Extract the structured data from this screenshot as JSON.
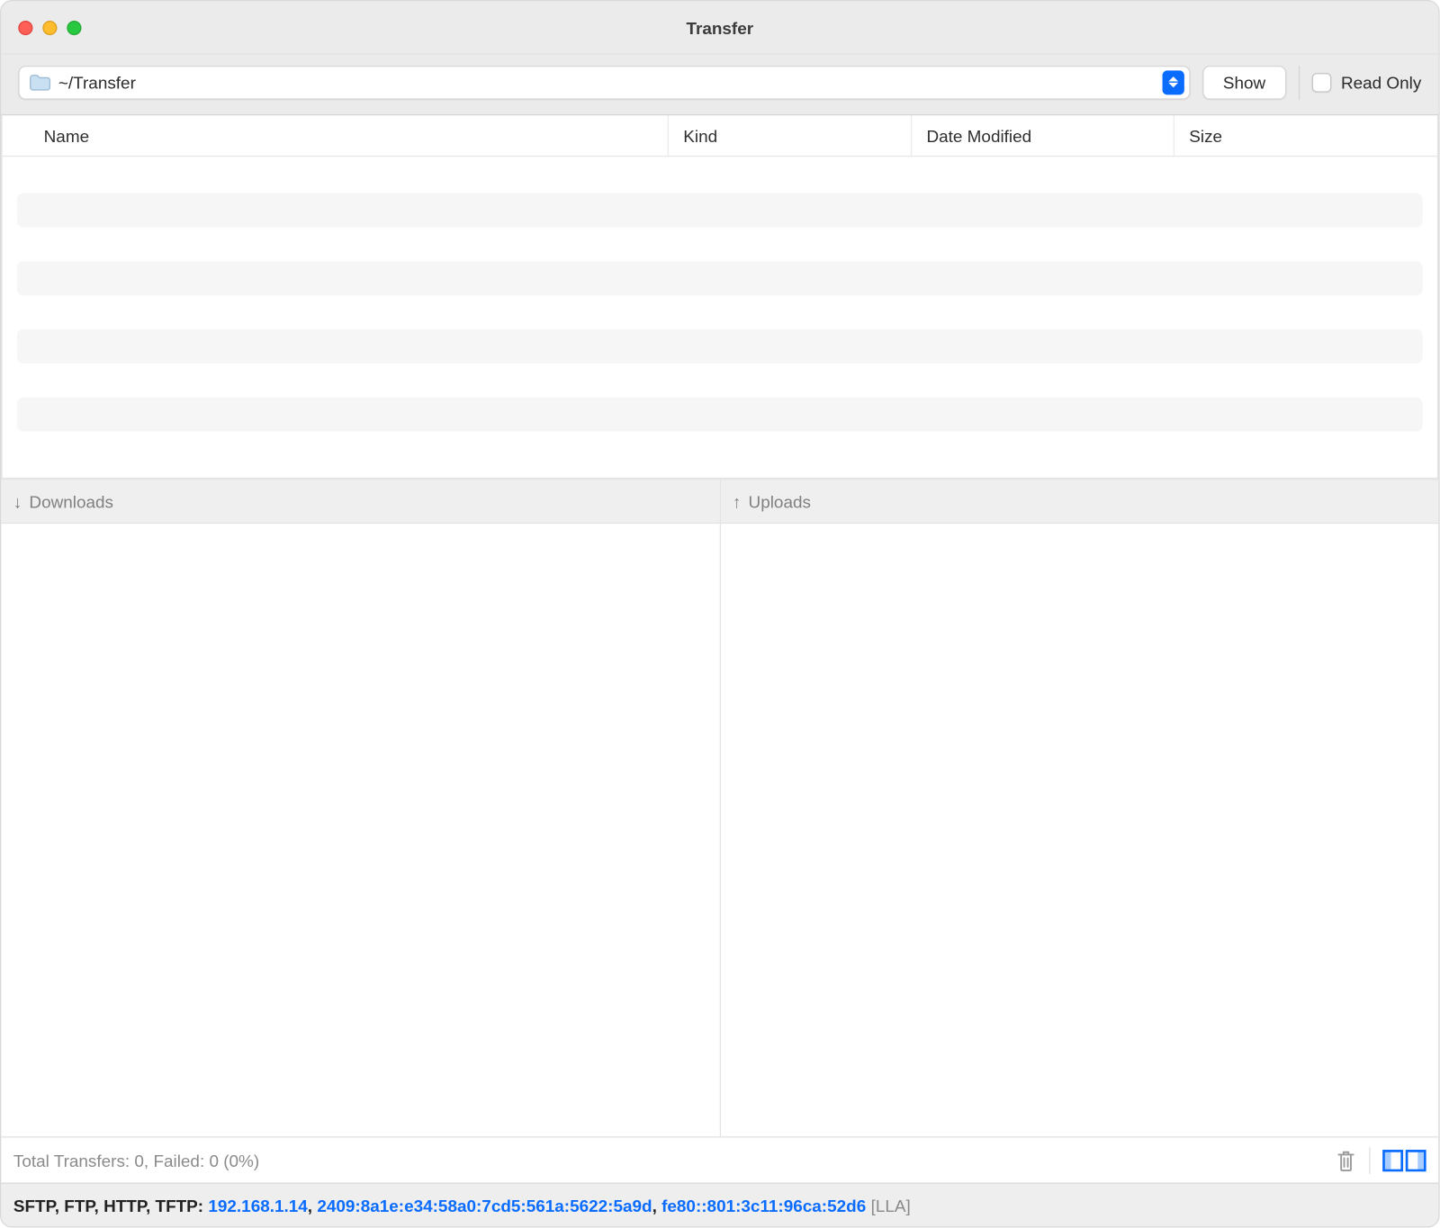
{
  "titlebar": {
    "title": "Transfer"
  },
  "toolbar": {
    "path": "~/Transfer",
    "show_label": "Show",
    "readonly_label": "Read Only",
    "readonly_checked": false
  },
  "table": {
    "columns": {
      "name": "Name",
      "kind": "Kind",
      "date": "Date Modified",
      "size": "Size"
    }
  },
  "panels": {
    "downloads_label": "Downloads",
    "uploads_label": "Uploads"
  },
  "status": {
    "text": "Total Transfers: 0, Failed: 0 (0%)"
  },
  "server": {
    "protocols": "SFTP, FTP, HTTP, TFTP:",
    "ips": [
      "192.168.1.14",
      "2409:8a1e:e34:58a0:7cd5:561a:5622:5a9d",
      "fe80::801:3c11:96ca:52d6"
    ],
    "lla_tag": "[LLA]"
  }
}
